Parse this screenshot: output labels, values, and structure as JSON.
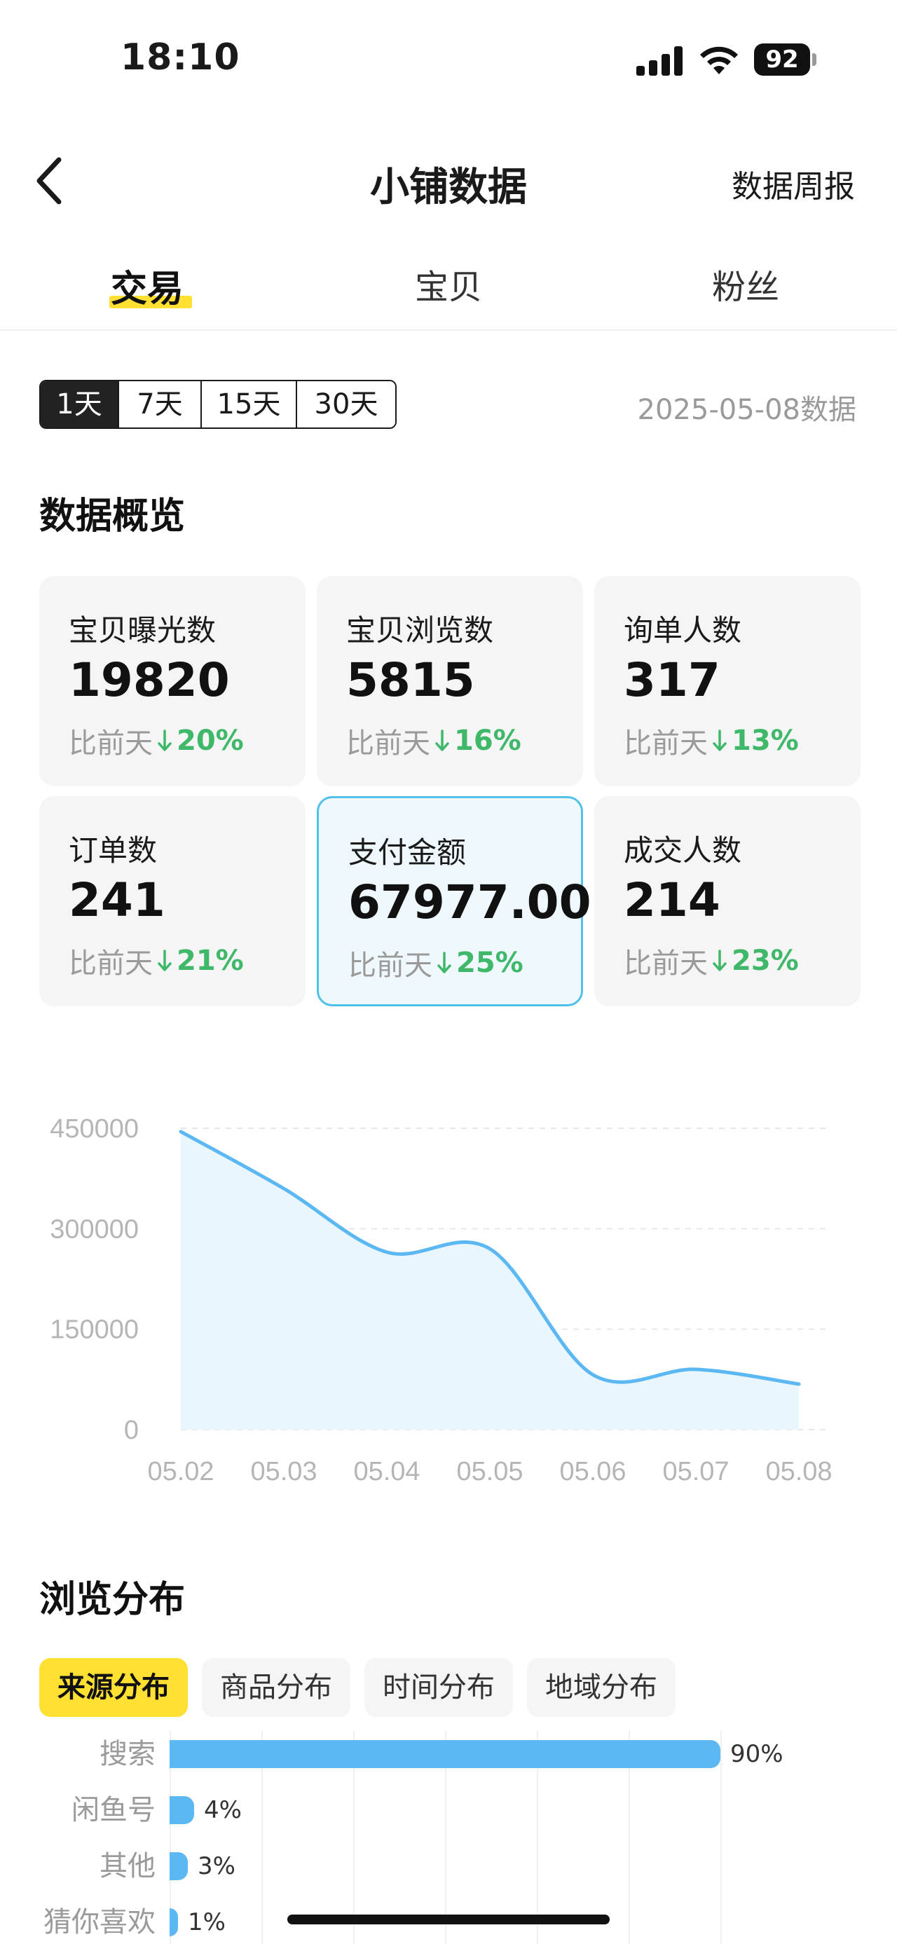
{
  "status_bar": {
    "time": "18:10",
    "battery": "92"
  },
  "nav": {
    "title": "小铺数据",
    "right_link": "数据周报"
  },
  "tabs": [
    {
      "label": "交易",
      "active": true
    },
    {
      "label": "宝贝",
      "active": false
    },
    {
      "label": "粉丝",
      "active": false
    }
  ],
  "range": {
    "options": [
      "1天",
      "7天",
      "15天",
      "30天"
    ],
    "selected": "1天"
  },
  "date_note": "2025-05-08数据",
  "overview": {
    "title": "数据概览",
    "compare_label": "比前天",
    "cards": [
      {
        "label": "宝贝曝光数",
        "value": "19820",
        "delta": "20%"
      },
      {
        "label": "宝贝浏览数",
        "value": "5815",
        "delta": "16%"
      },
      {
        "label": "询单人数",
        "value": "317",
        "delta": "13%"
      },
      {
        "label": "订单数",
        "value": "241",
        "delta": "21%"
      },
      {
        "label": "支付金额",
        "value": "67977.00",
        "delta": "25%",
        "highlighted": true
      },
      {
        "label": "成交人数",
        "value": "214",
        "delta": "23%"
      }
    ]
  },
  "chart_data": {
    "type": "area",
    "categories": [
      "05.02",
      "05.03",
      "05.04",
      "05.05",
      "05.06",
      "05.07",
      "05.08"
    ],
    "series": [
      {
        "values": [
          445000,
          360000,
          265000,
          270000,
          82000,
          90000,
          68000
        ]
      }
    ],
    "y_ticks": [
      "450000",
      "300000",
      "150000",
      "0"
    ],
    "ylim": [
      0,
      450000
    ],
    "grid": true,
    "colors": {
      "line": "#5bb8f3",
      "fill": "#eaf6fd",
      "grid": "#e6e6e6"
    }
  },
  "browse": {
    "title": "浏览分布",
    "tabs": [
      {
        "label": "来源分布",
        "active": true
      },
      {
        "label": "商品分布",
        "active": false
      },
      {
        "label": "时间分布",
        "active": false
      },
      {
        "label": "地域分布",
        "active": false
      }
    ],
    "sources": [
      {
        "label": "搜索",
        "percent": 90,
        "text": "90%"
      },
      {
        "label": "闲鱼号",
        "percent": 4,
        "text": "4%"
      },
      {
        "label": "其他",
        "percent": 3,
        "text": "3%"
      },
      {
        "label": "猜你喜欢",
        "percent": 1,
        "text": "1%"
      }
    ]
  },
  "colors": {
    "accent_yellow": "#ffe033",
    "down_green": "#3fb869",
    "highlight_border": "#52c1ea",
    "bar_blue": "#5bb8f3"
  }
}
